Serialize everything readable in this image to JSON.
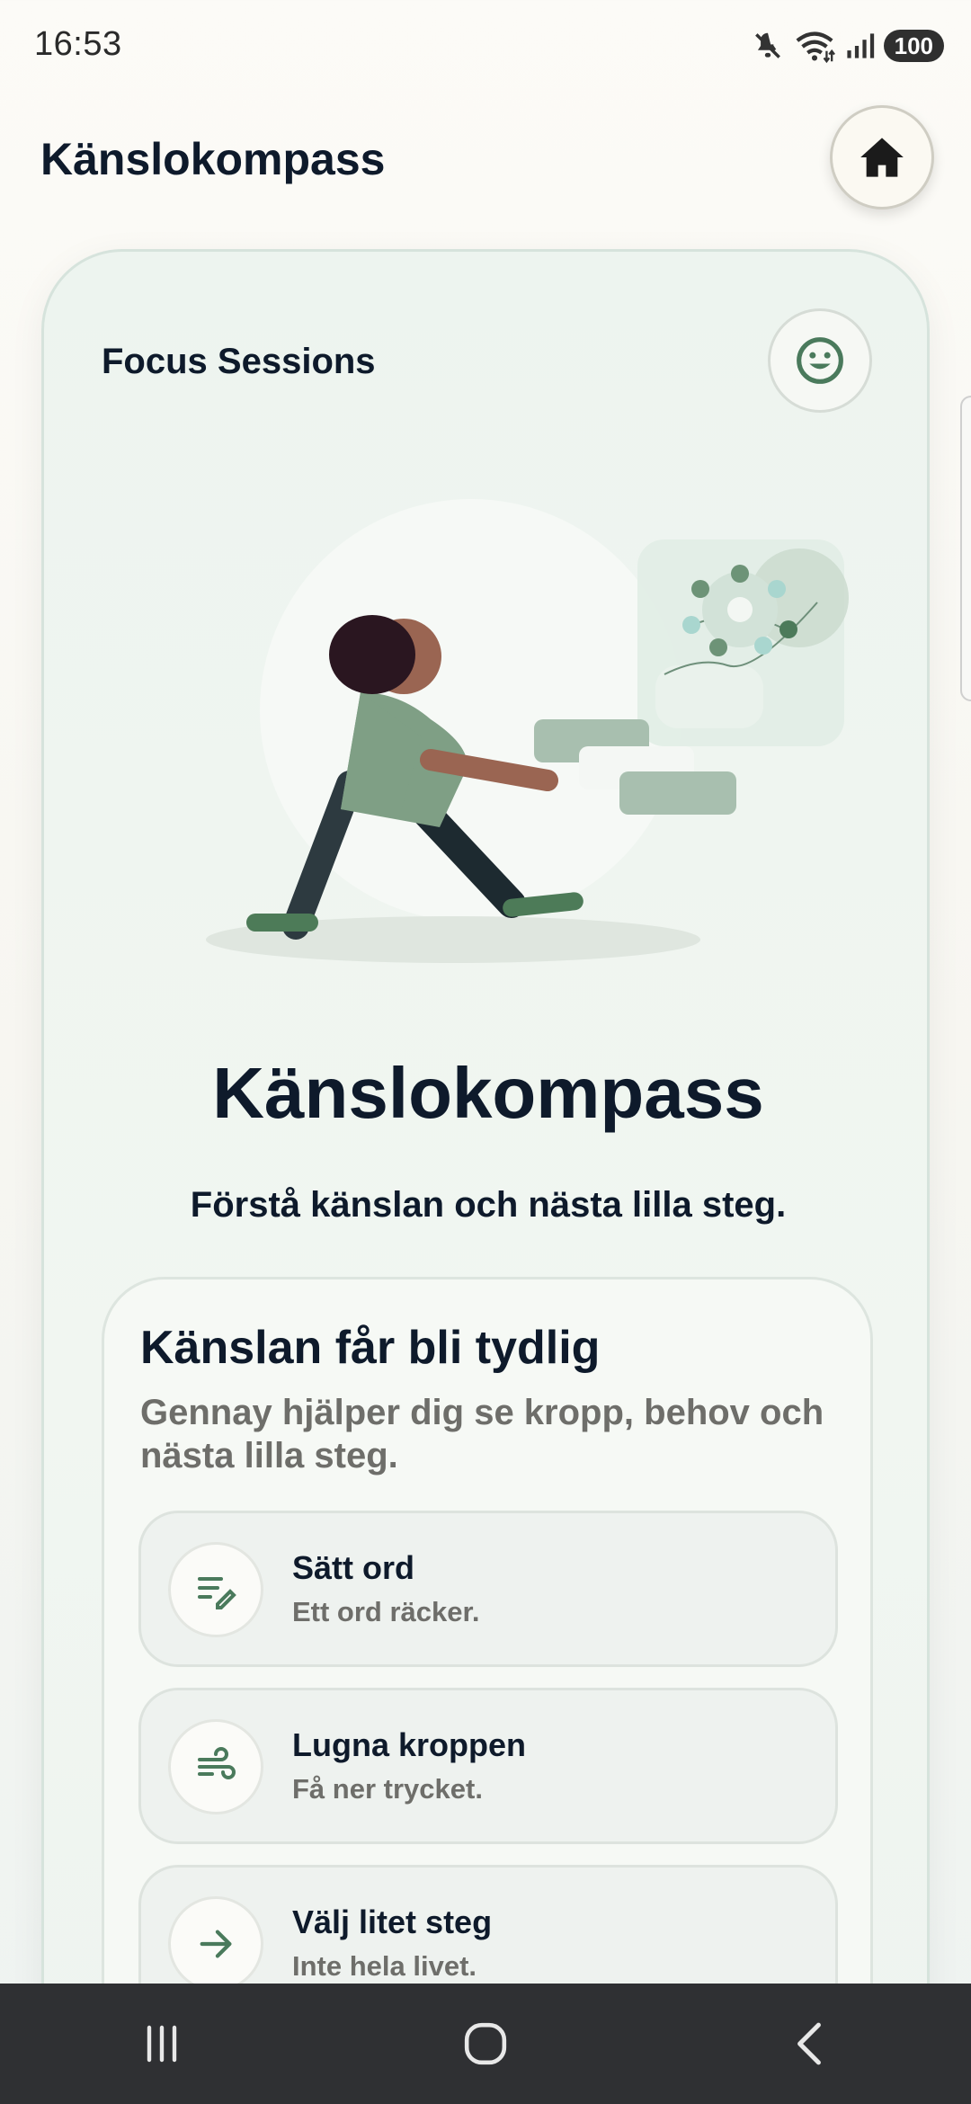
{
  "status_bar": {
    "time": "16:53",
    "battery": "100"
  },
  "header": {
    "title": "Känslokompass"
  },
  "card": {
    "label": "Focus Sessions",
    "hero_title": "Känslokompass",
    "hero_subtitle": "Förstå känslan och nästa lilla steg."
  },
  "info": {
    "title": "Känslan får bli tydlig",
    "description": "Gennay hjälper dig se kropp, behov och nästa lilla steg.",
    "options": [
      {
        "title": "Sätt ord",
        "subtitle": "Ett ord räcker.",
        "icon": "edit-notes-icon"
      },
      {
        "title": "Lugna kroppen",
        "subtitle": "Få ner trycket.",
        "icon": "wind-icon"
      },
      {
        "title": "Välj litet steg",
        "subtitle": "Inte hela livet.",
        "icon": "arrow-right-icon"
      }
    ]
  },
  "colors": {
    "accent": "#4a7a5c",
    "text": "#0e1a2b",
    "muted": "#6e6e6a"
  }
}
